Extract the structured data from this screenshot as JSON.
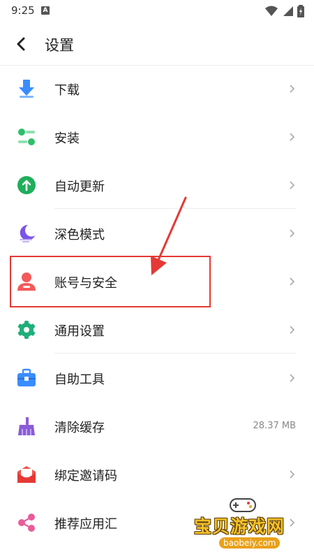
{
  "status_bar": {
    "time": "9:25",
    "notification_letter": "A"
  },
  "header": {
    "title": "设置"
  },
  "items": [
    {
      "label": "下载",
      "icon": "download-icon"
    },
    {
      "label": "安装",
      "icon": "install-toggle-icon"
    },
    {
      "label": "自动更新",
      "icon": "auto-update-icon"
    },
    {
      "label": "深色模式",
      "icon": "moon-icon"
    },
    {
      "label": "账号与安全",
      "icon": "account-icon"
    },
    {
      "label": "通用设置",
      "icon": "gear-icon"
    },
    {
      "label": "自助工具",
      "icon": "toolbox-icon"
    },
    {
      "label": "清除缓存",
      "icon": "broom-icon",
      "value": "28.37 MB"
    },
    {
      "label": "绑定邀请码",
      "icon": "envelope-icon"
    },
    {
      "label": "推荐应用汇",
      "icon": "share-icon"
    }
  ],
  "watermark": {
    "name": "宝贝游戏网",
    "domain": "baobeiy.com"
  },
  "colors": {
    "annotation": "#e53935",
    "divider": "#ededed",
    "watermark_gold": "#f3c12a"
  }
}
